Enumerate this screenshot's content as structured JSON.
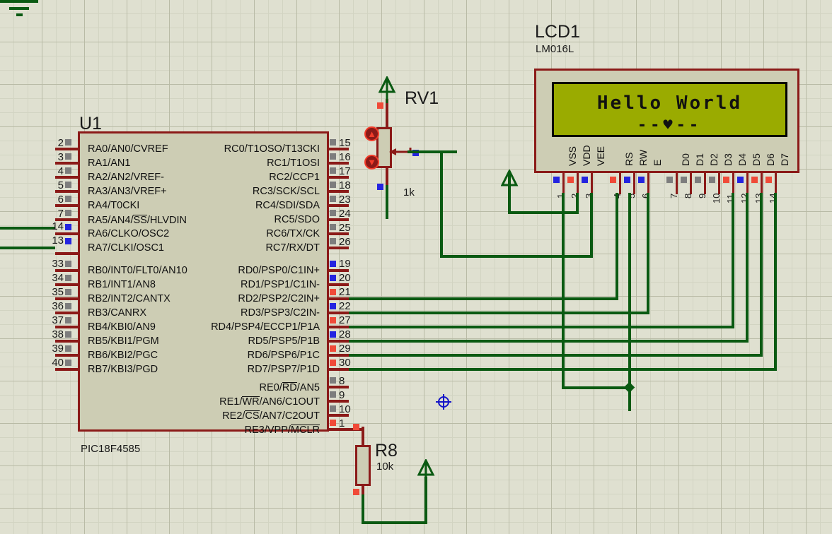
{
  "app": {
    "kind": "schematic-capture",
    "background_color": "#dfe0d0",
    "grid_major_color": "#b9bba6",
    "grid_minor_color": "#d2d4c2"
  },
  "colors": {
    "body_fill": "#cdcdb4",
    "body_outline": "#8b1a18",
    "wire": "#0a5a12",
    "lcd_screen": "#9aab00",
    "pin_red": "#f04a38",
    "pin_blue": "#2424e0",
    "pin_gray": "#7d7d7d",
    "cursor": "#1414c8"
  },
  "mcu": {
    "reference": "U1",
    "part_number": "PIC18F4585",
    "porta": [
      {
        "num": "2",
        "label": "RA0/AN0/CVREF",
        "state": "gray"
      },
      {
        "num": "3",
        "label": "RA1/AN1",
        "state": "gray"
      },
      {
        "num": "4",
        "label": "RA2/AN2/VREF-",
        "state": "gray"
      },
      {
        "num": "5",
        "label": "RA3/AN3/VREF+",
        "state": "gray"
      },
      {
        "num": "6",
        "label": "RA4/T0CKI",
        "state": "gray"
      },
      {
        "num": "7",
        "label": "RA5/AN4/SS/HLVDIN",
        "state": "gray",
        "overbar": "SS"
      },
      {
        "num": "14",
        "label": "RA6/CLKO/OSC2",
        "state": "blue"
      },
      {
        "num": "13",
        "label": "RA7/CLKI/OSC1",
        "state": "blue"
      }
    ],
    "portb": [
      {
        "num": "33",
        "label": "RB0/INT0/FLT0/AN10",
        "state": "gray"
      },
      {
        "num": "34",
        "label": "RB1/INT1/AN8",
        "state": "gray"
      },
      {
        "num": "35",
        "label": "RB2/INT2/CANTX",
        "state": "gray"
      },
      {
        "num": "36",
        "label": "RB3/CANRX",
        "state": "gray"
      },
      {
        "num": "37",
        "label": "RB4/KBI0/AN9",
        "state": "gray"
      },
      {
        "num": "38",
        "label": "RB5/KBI1/PGM",
        "state": "gray"
      },
      {
        "num": "39",
        "label": "RB6/KBI2/PGC",
        "state": "gray"
      },
      {
        "num": "40",
        "label": "RB7/KBI3/PGD",
        "state": "gray"
      }
    ],
    "portc": [
      {
        "num": "15",
        "label": "RC0/T1OSO/T13CKI",
        "state": "gray"
      },
      {
        "num": "16",
        "label": "RC1/T1OSI",
        "state": "gray"
      },
      {
        "num": "17",
        "label": "RC2/CCP1",
        "state": "gray"
      },
      {
        "num": "18",
        "label": "RC3/SCK/SCL",
        "state": "gray"
      },
      {
        "num": "23",
        "label": "RC4/SDI/SDA",
        "state": "gray"
      },
      {
        "num": "24",
        "label": "RC5/SDO",
        "state": "gray"
      },
      {
        "num": "25",
        "label": "RC6/TX/CK",
        "state": "gray"
      },
      {
        "num": "26",
        "label": "RC7/RX/DT",
        "state": "gray"
      }
    ],
    "portd": [
      {
        "num": "19",
        "label": "RD0/PSP0/C1IN+",
        "state": "blue"
      },
      {
        "num": "20",
        "label": "RD1/PSP1/C1IN-",
        "state": "blue"
      },
      {
        "num": "21",
        "label": "RD2/PSP2/C2IN+",
        "state": "red"
      },
      {
        "num": "22",
        "label": "RD3/PSP3/C2IN-",
        "state": "blue"
      },
      {
        "num": "27",
        "label": "RD4/PSP4/ECCP1/P1A",
        "state": "red"
      },
      {
        "num": "28",
        "label": "RD5/PSP5/P1B",
        "state": "blue"
      },
      {
        "num": "29",
        "label": "RD6/PSP6/P1C",
        "state": "red"
      },
      {
        "num": "30",
        "label": "RD7/PSP7/P1D",
        "state": "red"
      }
    ],
    "porte": [
      {
        "num": "8",
        "label": "RE0/RD/AN5",
        "state": "gray",
        "overbar": "RD"
      },
      {
        "num": "9",
        "label": "RE1/WR/AN6/C1OUT",
        "state": "gray",
        "overbar": "WR"
      },
      {
        "num": "10",
        "label": "RE2/CS/AN7/C2OUT",
        "state": "gray",
        "overbar": "CS"
      },
      {
        "num": "1",
        "label": "RE3/VPP/MCLR",
        "state": "red",
        "overbar": "MCLR"
      }
    ]
  },
  "lcd": {
    "reference": "LCD1",
    "part_number": "LM016L",
    "line1": "Hello World",
    "line2": "--♥--",
    "pins": [
      {
        "num": "1",
        "label": "VSS",
        "state": "blue"
      },
      {
        "num": "2",
        "label": "VDD",
        "state": "red"
      },
      {
        "num": "3",
        "label": "VEE",
        "state": "blue"
      },
      {
        "num": "4",
        "label": "RS",
        "state": "red"
      },
      {
        "num": "5",
        "label": "RW",
        "state": "blue"
      },
      {
        "num": "6",
        "label": "E",
        "state": "blue"
      },
      {
        "num": "7",
        "label": "D0",
        "state": "gray"
      },
      {
        "num": "8",
        "label": "D1",
        "state": "gray"
      },
      {
        "num": "9",
        "label": "D2",
        "state": "gray"
      },
      {
        "num": "10",
        "label": "D3",
        "state": "gray"
      },
      {
        "num": "11",
        "label": "D4",
        "state": "red"
      },
      {
        "num": "12",
        "label": "D5",
        "state": "blue"
      },
      {
        "num": "13",
        "label": "D6",
        "state": "red"
      },
      {
        "num": "14",
        "label": "D7",
        "state": "red"
      }
    ]
  },
  "pot": {
    "reference": "RV1",
    "value": "1k",
    "increase_glyph": "▲",
    "decrease_glyph": "▼"
  },
  "resistor": {
    "reference": "R8",
    "value": "10k"
  }
}
